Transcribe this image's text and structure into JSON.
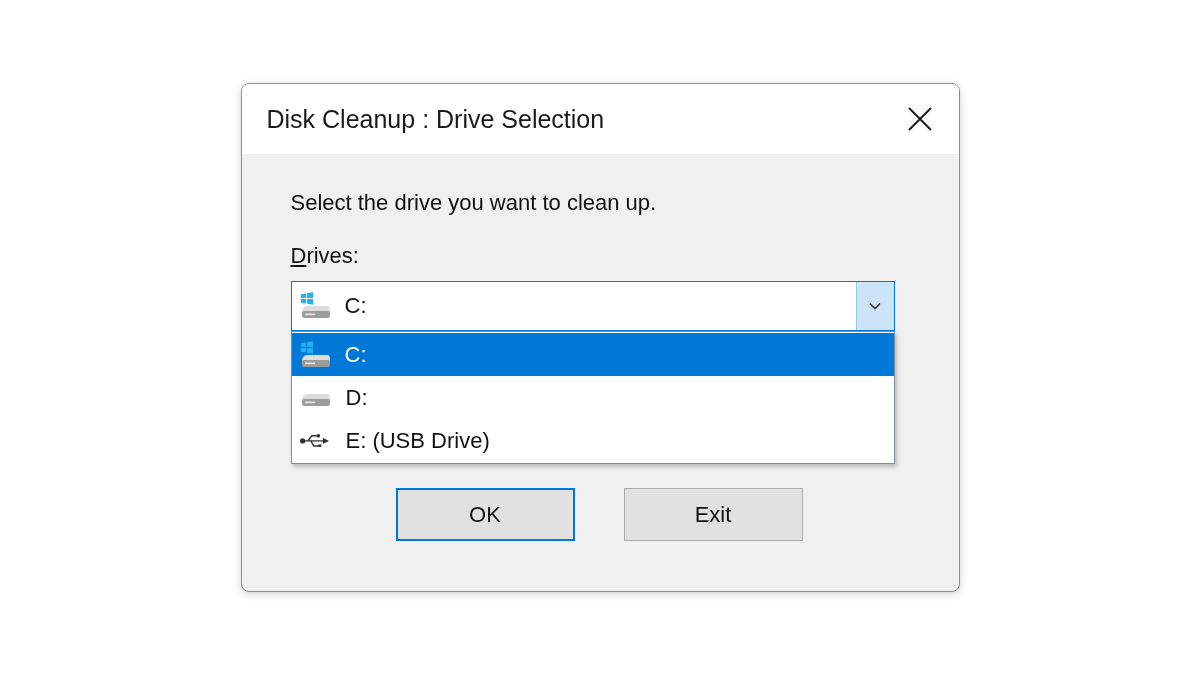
{
  "window": {
    "title": "Disk Cleanup : Drive Selection"
  },
  "instruction": "Select the drive you want to clean up.",
  "drives_field": {
    "label": "Drives:",
    "access_key_underlined": true,
    "focused": true,
    "expanded": true,
    "value": {
      "label": "C:",
      "kind": "system"
    }
  },
  "drive_list": [
    {
      "label": "C:",
      "kind": "system",
      "selected": true
    },
    {
      "label": "D:",
      "kind": "disk",
      "selected": false
    },
    {
      "label": "E: (USB Drive)",
      "kind": "usb",
      "selected": false
    }
  ],
  "buttons": [
    {
      "label": "OK",
      "default": true
    },
    {
      "label": "Exit",
      "default": false
    }
  ]
}
